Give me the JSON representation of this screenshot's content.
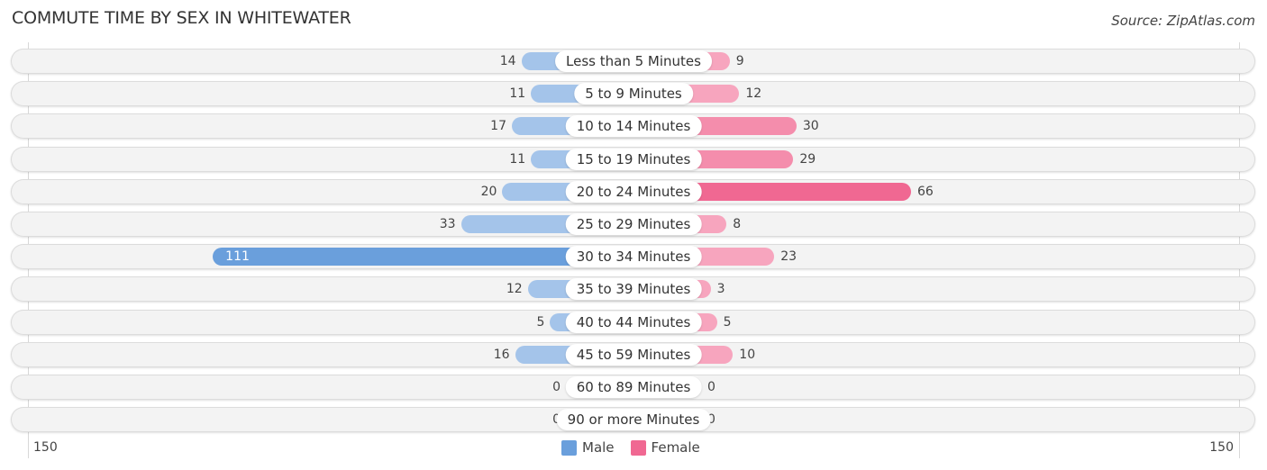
{
  "title": "COMMUTE TIME BY SEX IN WHITEWATER",
  "source": "Source: ZipAtlas.com",
  "colors": {
    "male": "#6a9fdc",
    "male_light": "#a4c4ea",
    "female": "#f06892",
    "female_light": "#f7a5be"
  },
  "chart_data": {
    "type": "bar",
    "orientation": "horizontal-diverging",
    "title": "COMMUTE TIME BY SEX IN WHITEWATER",
    "categories": [
      "Less than 5 Minutes",
      "5 to 9 Minutes",
      "10 to 14 Minutes",
      "15 to 19 Minutes",
      "20 to 24 Minutes",
      "25 to 29 Minutes",
      "30 to 34 Minutes",
      "35 to 39 Minutes",
      "40 to 44 Minutes",
      "45 to 59 Minutes",
      "60 to 89 Minutes",
      "90 or more Minutes"
    ],
    "series": [
      {
        "name": "Male",
        "values": [
          14,
          11,
          17,
          11,
          20,
          33,
          111,
          12,
          5,
          16,
          0,
          0
        ]
      },
      {
        "name": "Female",
        "values": [
          9,
          12,
          30,
          29,
          66,
          8,
          23,
          3,
          5,
          10,
          0,
          0
        ]
      }
    ],
    "axis": {
      "left_label": "150",
      "right_label": "150",
      "range": [
        0,
        150
      ]
    },
    "legend": {
      "position": "bottom-center",
      "items": [
        "Male",
        "Female"
      ]
    },
    "grid": false
  }
}
